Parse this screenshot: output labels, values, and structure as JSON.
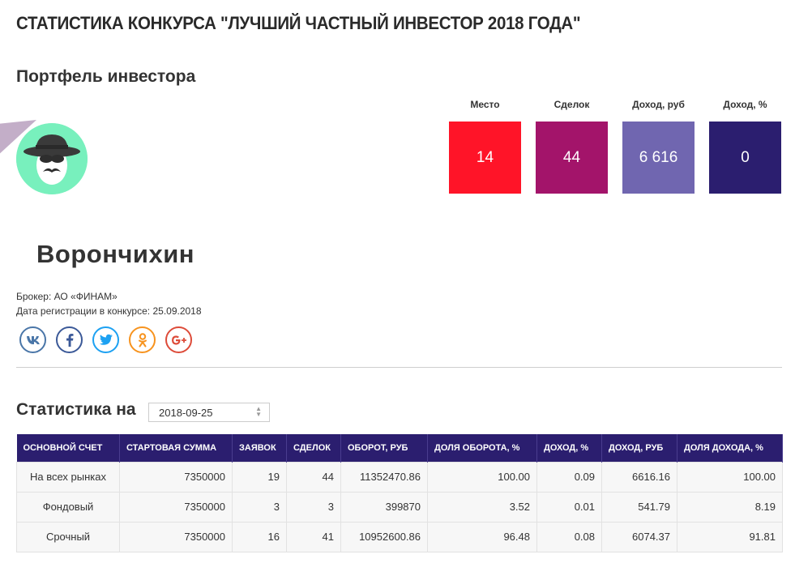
{
  "page": {
    "title": "СТАТИСТИКА КОНКУРСА \"ЛУЧШИЙ ЧАСТНЫЙ ИНВЕСТОР 2018 ГОДА\"",
    "section_title": "Портфель инвестора"
  },
  "summary": {
    "items": [
      {
        "label": "Место",
        "value": "14",
        "color": "#ff1428"
      },
      {
        "label": "Сделок",
        "value": "44",
        "color": "#a3146a"
      },
      {
        "label": "Доход, руб",
        "value": "6 616",
        "color": "#7066b0"
      },
      {
        "label": "Доход, %",
        "value": "0",
        "color": "#2b1e6f"
      }
    ]
  },
  "investor": {
    "name": "Ворончихин",
    "broker_label": "Брокер:",
    "broker_value": "АО «ФИНАМ»",
    "reg_label": "Дата регистрации в конкурсе:",
    "reg_value": "25.09.2018"
  },
  "socials": [
    {
      "name": "vk",
      "icon": "vk-icon",
      "color": "#4a76a8"
    },
    {
      "name": "facebook",
      "icon": "facebook-icon",
      "color": "#3b5998"
    },
    {
      "name": "twitter",
      "icon": "twitter-icon",
      "color": "#1da1f2"
    },
    {
      "name": "odnoklassniki",
      "icon": "odnoklassniki-icon",
      "color": "#f7931e"
    },
    {
      "name": "google-plus",
      "icon": "google-plus-icon",
      "color": "#dd4b39"
    }
  ],
  "stats": {
    "label": "Статистика на",
    "date": "2018-09-25",
    "columns": [
      "ОСНОВНОЙ СЧЕТ",
      "СТАРТОВАЯ СУММА",
      "ЗАЯВОК",
      "СДЕЛОК",
      "ОБОРОТ, РУБ",
      "ДОЛЯ ОБОРОТА, %",
      "ДОХОД, %",
      "ДОХОД, РУБ",
      "ДОЛЯ ДОХОДА, %"
    ],
    "rows": [
      [
        "На всех рынках",
        "7350000",
        "19",
        "44",
        "11352470.86",
        "100.00",
        "0.09",
        "6616.16",
        "100.00"
      ],
      [
        "Фондовый",
        "7350000",
        "3",
        "3",
        "399870",
        "3.52",
        "0.01",
        "541.79",
        "8.19"
      ],
      [
        "Срочный",
        "7350000",
        "16",
        "41",
        "10952600.86",
        "96.48",
        "0.08",
        "6074.37",
        "91.81"
      ]
    ]
  }
}
